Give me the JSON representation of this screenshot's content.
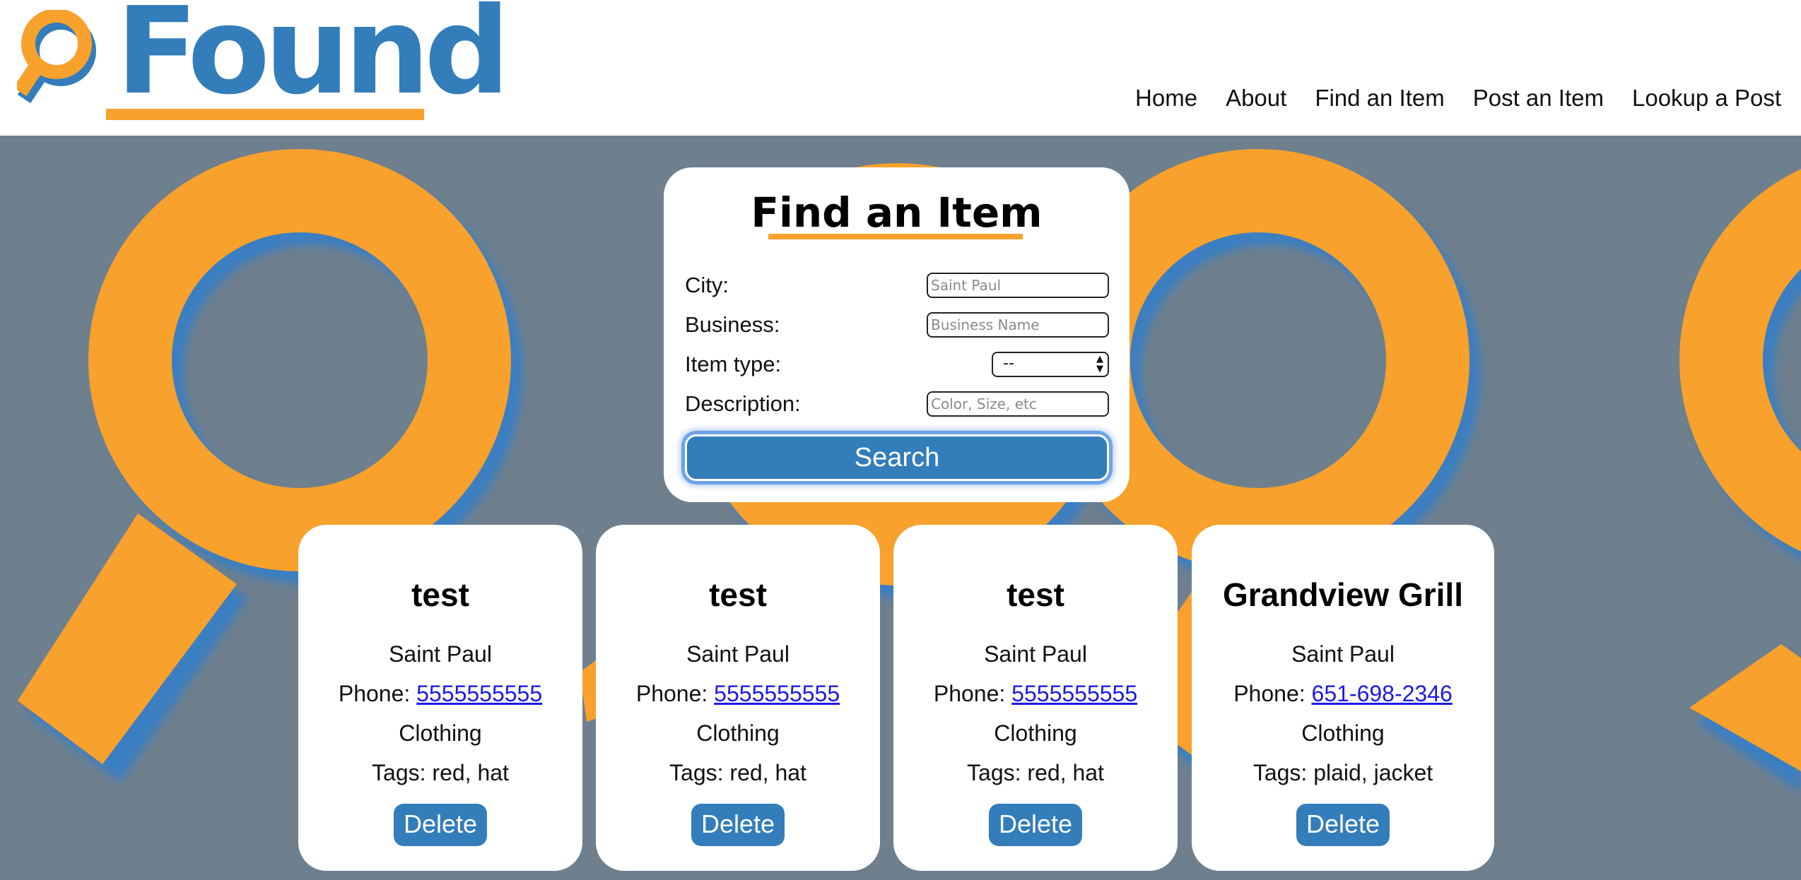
{
  "brand": {
    "name": "Found",
    "logo_icon": "magnifier-icon",
    "accent": "#f8a12c",
    "primary": "#337dbb"
  },
  "nav": [
    {
      "label": "Home"
    },
    {
      "label": "About"
    },
    {
      "label": "Find an Item"
    },
    {
      "label": "Post an Item"
    },
    {
      "label": "Lookup a Post"
    }
  ],
  "search_form": {
    "title": "Find an Item",
    "city": {
      "label": "City:",
      "placeholder": "Saint Paul"
    },
    "business": {
      "label": "Business:",
      "placeholder": "Business Name"
    },
    "item_type": {
      "label": "Item type:",
      "selected": "--"
    },
    "description": {
      "label": "Description:",
      "placeholder": "Color, Size, etc"
    },
    "search_label": "Search"
  },
  "results": [
    {
      "name": "test",
      "city": "Saint Paul",
      "phone_prefix": "Phone: ",
      "phone": "5555555555",
      "type": "Clothing",
      "tags": "Tags: red, hat",
      "delete_label": "Delete"
    },
    {
      "name": "test",
      "city": "Saint Paul",
      "phone_prefix": "Phone: ",
      "phone": "5555555555",
      "type": "Clothing",
      "tags": "Tags: red, hat",
      "delete_label": "Delete"
    },
    {
      "name": "test",
      "city": "Saint Paul",
      "phone_prefix": "Phone: ",
      "phone": "5555555555",
      "type": "Clothing",
      "tags": "Tags: red, hat",
      "delete_label": "Delete"
    },
    {
      "name": "Grandview Grill",
      "city": "Saint Paul",
      "phone_prefix": "Phone: ",
      "phone": "651-698-2346",
      "type": "Clothing",
      "tags": "Tags: plaid, jacket",
      "delete_label": "Delete"
    }
  ]
}
